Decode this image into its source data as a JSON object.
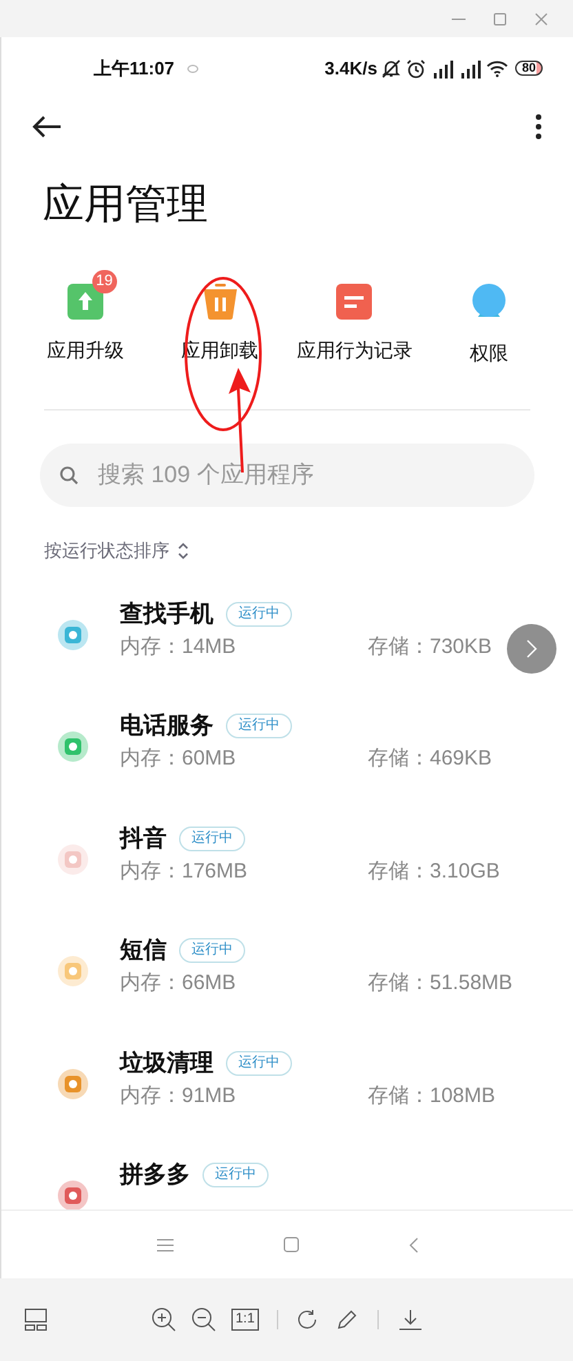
{
  "status_bar": {
    "time": "上午11:07",
    "speed": "3.4K/s",
    "battery": "80"
  },
  "header": {
    "title": "应用管理"
  },
  "quick_actions": [
    {
      "kind": "upgrade",
      "label": "应用升级",
      "badge": "19"
    },
    {
      "kind": "uninstall",
      "label": "应用卸载"
    },
    {
      "kind": "record",
      "label": "应用行为记录"
    },
    {
      "kind": "permission",
      "label": "权限"
    }
  ],
  "search": {
    "placeholder": "搜索 109 个应用程序"
  },
  "sort": {
    "label": "按运行状态排序"
  },
  "apps": [
    {
      "name": "查找手机",
      "status": "运行中",
      "memory": "内存：14MB",
      "storage": "存储：730KB",
      "color": "#3bb6d6"
    },
    {
      "name": "电话服务",
      "status": "运行中",
      "memory": "内存：60MB",
      "storage": "存储：469KB",
      "color": "#2fc26b"
    },
    {
      "name": "抖音",
      "status": "运行中",
      "memory": "内存：176MB",
      "storage": "存储：3.10GB",
      "color": "#f3c7c4"
    },
    {
      "name": "短信",
      "status": "运行中",
      "memory": "内存：66MB",
      "storage": "存储：51.58MB",
      "color": "#f8c77a"
    },
    {
      "name": "垃圾清理",
      "status": "运行中",
      "memory": "内存：91MB",
      "storage": "存储：108MB",
      "color": "#e8922a"
    },
    {
      "name": "拼多多",
      "status": "运行中",
      "color": "#e05a5a"
    }
  ],
  "viewer_toolbar": {
    "actual_size": "1:1"
  }
}
